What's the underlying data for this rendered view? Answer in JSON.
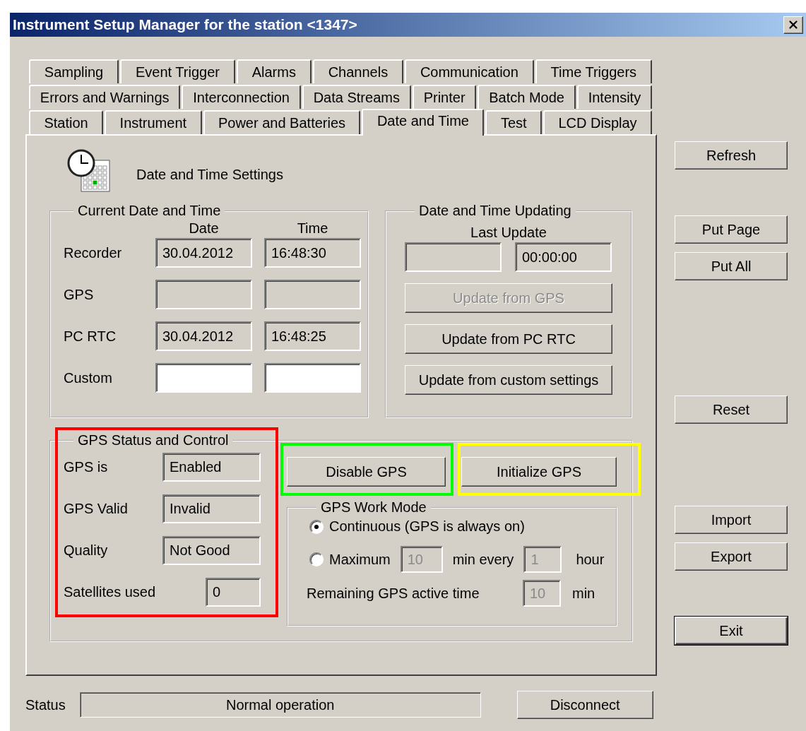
{
  "window": {
    "title": "Instrument Setup Manager for the station <1347>"
  },
  "tab_rows": [
    [
      {
        "label": "Sampling",
        "selected": false
      },
      {
        "label": "Event Trigger",
        "selected": false
      },
      {
        "label": "Alarms",
        "selected": false
      },
      {
        "label": "Channels",
        "selected": false
      },
      {
        "label": "Communication",
        "selected": false
      },
      {
        "label": "Time Triggers",
        "selected": false
      }
    ],
    [
      {
        "label": "Errors and Warnings",
        "selected": false
      },
      {
        "label": "Interconnection",
        "selected": false
      },
      {
        "label": "Data Streams",
        "selected": false
      },
      {
        "label": "Printer",
        "selected": false
      },
      {
        "label": "Batch Mode",
        "selected": false
      },
      {
        "label": "Intensity",
        "selected": false
      }
    ],
    [
      {
        "label": "Station",
        "selected": false
      },
      {
        "label": "Instrument",
        "selected": false
      },
      {
        "label": "Power and Batteries",
        "selected": false
      },
      {
        "label": "Date and Time",
        "selected": true
      },
      {
        "label": "Test",
        "selected": false
      },
      {
        "label": "LCD Display",
        "selected": false
      }
    ]
  ],
  "page": {
    "heading": "Date and Time Settings"
  },
  "current": {
    "title": "Current Date and Time",
    "columns": [
      "Date",
      "Time"
    ],
    "rows": [
      {
        "label": "Recorder",
        "date": "30.04.2012",
        "time": "16:48:30",
        "editable": false
      },
      {
        "label": "GPS",
        "editable": false
      },
      {
        "label": "PC RTC",
        "date": "30.04.2012",
        "time": "16:48:25",
        "editable": false
      },
      {
        "label": "Custom",
        "editable": true
      }
    ]
  },
  "updating": {
    "title": "Date and Time Updating",
    "last_update_label": "Last Update",
    "last_update_time": "00:00:00",
    "buttons": [
      {
        "label": "Update from GPS",
        "disabled": true
      },
      {
        "label": "Update from PC RTC",
        "disabled": false
      },
      {
        "label": "Update from custom settings",
        "disabled": false
      }
    ]
  },
  "gps": {
    "title": "GPS Status and Control",
    "fields": [
      {
        "label": "GPS is",
        "value": "Enabled",
        "kind": "wide"
      },
      {
        "label": "GPS Valid",
        "value": "Invalid",
        "kind": "wide"
      },
      {
        "label": "Quality",
        "value": "Not Good",
        "kind": "wide"
      },
      {
        "label": "Satellites used",
        "value": "0",
        "kind": "narrow"
      }
    ],
    "buttons": [
      "Disable GPS",
      "Initialize GPS"
    ],
    "work_mode": {
      "title": "GPS Work Mode",
      "options": [
        {
          "label": "Continuous (GPS is always on)",
          "selected": true
        },
        {
          "label": "Maximum",
          "selected": false,
          "minutes": "10",
          "minutes_unit": "min every",
          "hours": "1",
          "hours_unit": "hour",
          "fields_disabled": true
        }
      ],
      "remaining_label": "Remaining GPS active time",
      "remaining_value": "10",
      "remaining_unit": "min",
      "remaining_disabled": true
    }
  },
  "side_buttons": [
    [
      {
        "label": "Refresh",
        "default": false
      }
    ],
    [
      {
        "label": "Put Page",
        "default": false
      },
      {
        "label": "Put All",
        "default": false
      }
    ],
    [
      {
        "label": "Reset",
        "default": false
      }
    ],
    [
      {
        "label": "Import",
        "default": false
      },
      {
        "label": "Export",
        "default": false
      }
    ],
    [
      {
        "label": "Exit",
        "default": true
      }
    ]
  ],
  "status": {
    "label": "Status",
    "value": "Normal operation"
  },
  "disconnect": "Disconnect",
  "highlights": [
    {
      "color": "#ff0000"
    },
    {
      "color": "#00ff00"
    },
    {
      "color": "#ffff00"
    }
  ]
}
